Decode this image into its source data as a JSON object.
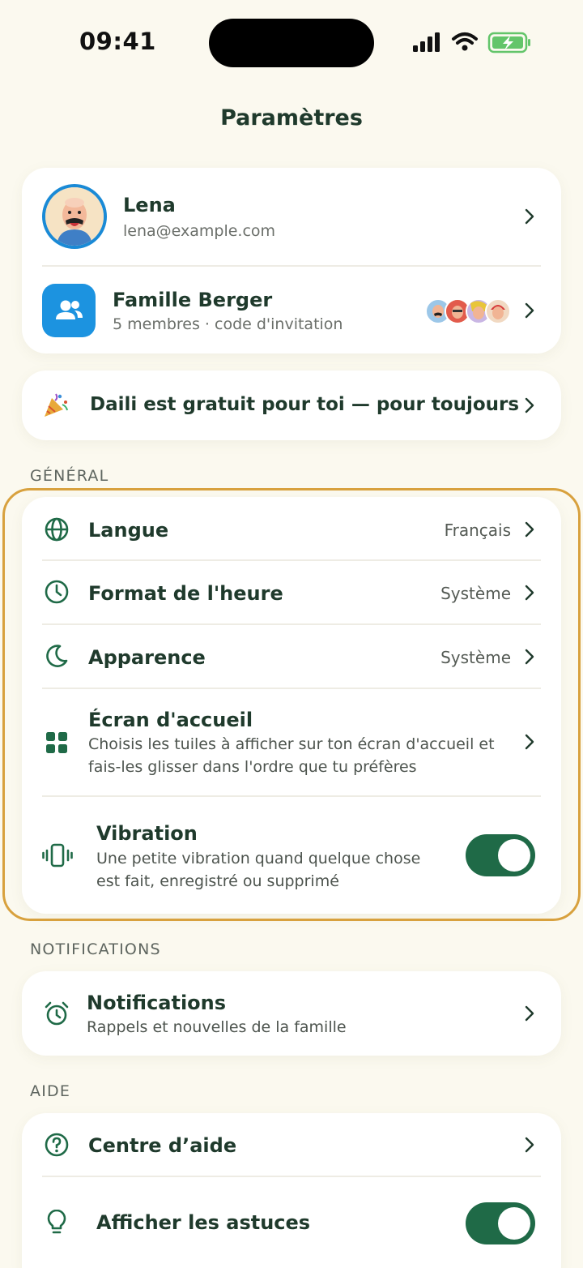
{
  "status_bar": {
    "time": "09:41"
  },
  "page": {
    "title": "Paramètres"
  },
  "profile": {
    "name": "Lena",
    "email": "lena@example.com"
  },
  "family": {
    "name": "Famille Berger",
    "subtitle": "5 membres · code d'invitation"
  },
  "promo": {
    "text": "Daili est gratuit pour toi — pour toujours"
  },
  "general": {
    "section_label": "GÉNÉRAL",
    "language": {
      "label": "Langue",
      "value": "Français"
    },
    "time_format": {
      "label": "Format de l'heure",
      "value": "Système"
    },
    "appearance": {
      "label": "Apparence",
      "value": "Système"
    },
    "home_screen": {
      "label": "Écran d'accueil",
      "desc_line1": "Choisis les tuiles à afficher sur ton écran d'accueil et",
      "desc_line2": "fais-les glisser dans l'ordre que tu préfères"
    },
    "vibration": {
      "label": "Vibration",
      "desc_line1": "Une petite vibration quand quelque chose",
      "desc_line2": "est fait, enregistré ou supprimé",
      "enabled": true
    }
  },
  "notifications": {
    "section_label": "NOTIFICATIONS",
    "item": {
      "label": "Notifications",
      "desc": "Rappels et nouvelles de la famille"
    }
  },
  "help": {
    "section_label": "AIDE",
    "help_center": {
      "label": "Centre d’aide"
    },
    "tips": {
      "label": "Afficher les astuces",
      "enabled": true
    }
  },
  "colors": {
    "accent": "#1f6a47",
    "highlight": "#d8a13e",
    "background": "#fbf9ef"
  }
}
